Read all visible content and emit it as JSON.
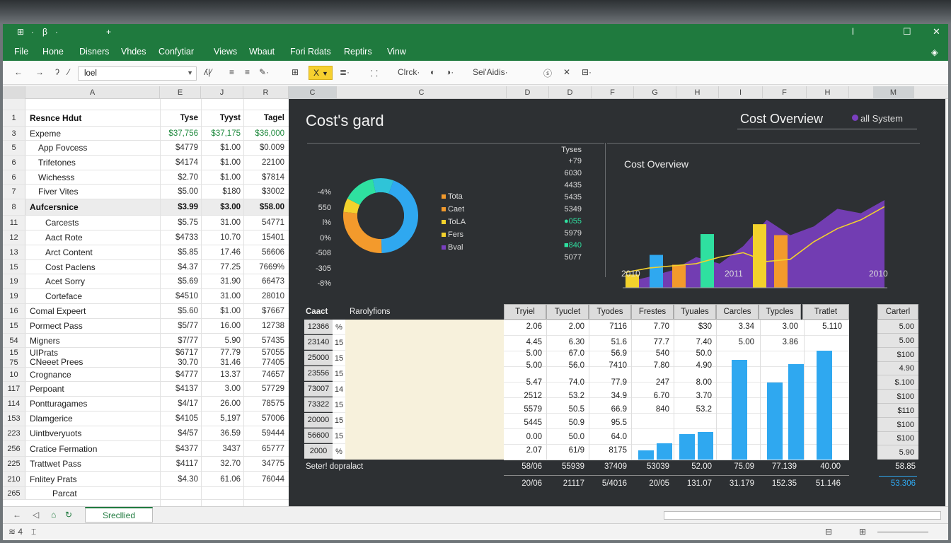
{
  "titlebar": {
    "quick_access": [
      "⊞",
      "·",
      "β",
      "·",
      "+"
    ],
    "window_controls": [
      "l",
      "☐",
      "✕"
    ]
  },
  "menu": [
    "File",
    "Hone",
    "Disners",
    "Vhdes",
    "Confytiar",
    "Views",
    "Wbaut",
    "Fori Rdats",
    "Reptirs",
    "Vinw"
  ],
  "menu_extra_icon": "◈",
  "toolbar": {
    "nav": [
      "←",
      "→",
      "ʔ",
      "⁄"
    ],
    "font_name": "loel",
    "items": [
      "ʎ|⁄",
      "≡",
      "≡",
      "✎·",
      "⊞",
      "X",
      "≣·",
      "⸬",
      "Clrck·",
      "◐",
      "◑·",
      "Sei'Aidis·",
      "ⓢ",
      "✕",
      "⊟·"
    ],
    "highlight_label": "X"
  },
  "col_headers": [
    "A",
    "E",
    "J",
    "R",
    "C",
    "C",
    "D",
    "D",
    "F",
    "G",
    "H",
    "I",
    "F",
    "H",
    "M"
  ],
  "sheet": {
    "rows": [
      {
        "rn": "",
        "name": "",
        "v": [
          "",
          "",
          ""
        ],
        "style": "spacer"
      },
      {
        "rn": "1",
        "name": "Resnce Hdut",
        "v": [
          "Tyse",
          "Tyyst",
          "Tagel"
        ],
        "style": "bold"
      },
      {
        "rn": "3",
        "name": "Expeme",
        "v": [
          "$37,756",
          "$37,175",
          "$36,000"
        ],
        "style": "green"
      },
      {
        "rn": "5",
        "name": "App Fovcess",
        "v": [
          "$4779",
          "$1.00",
          "$0.009"
        ],
        "indent": 1
      },
      {
        "rn": "6",
        "name": "Trifetones",
        "v": [
          "$4174",
          "$1.00",
          "22100"
        ],
        "indent": 1
      },
      {
        "rn": "6",
        "name": "Wichesss",
        "v": [
          "$2.70",
          "$1.00",
          "$7814"
        ],
        "indent": 1
      },
      {
        "rn": "7",
        "name": "Fiver Vites",
        "v": [
          "$5.00",
          "$180",
          "$3002"
        ],
        "indent": 1
      },
      {
        "rn": "8",
        "name": "Aufcersnice",
        "v": [
          "$3.99",
          "$3.00",
          "$58.00"
        ],
        "style": "bold shaded"
      },
      {
        "rn": "11",
        "name": "Carcests",
        "v": [
          "$5.75",
          "31.00",
          "54771"
        ],
        "indent": 2
      },
      {
        "rn": "12",
        "name": "Aact Rote",
        "v": [
          "$4733",
          "10.70",
          "15401"
        ],
        "indent": 2
      },
      {
        "rn": "13",
        "name": "Arct Content",
        "v": [
          "$5.85",
          "17.46",
          "56606"
        ],
        "indent": 2
      },
      {
        "rn": "15",
        "name": "Cost Paclens",
        "v": [
          "$4.37",
          "77.25",
          "7669%"
        ],
        "indent": 2
      },
      {
        "rn": "19",
        "name": "Acet Sorry",
        "v": [
          "$5.69",
          "31.90",
          "66473"
        ],
        "indent": 2
      },
      {
        "rn": "19",
        "name": "Corteface",
        "v": [
          "$4510",
          "31.00",
          "28010"
        ],
        "indent": 2
      },
      {
        "rn": "16",
        "name": "Comal Expeert",
        "v": [
          "$5.60",
          "$1.00",
          "$7667"
        ]
      },
      {
        "rn": "15",
        "name": "Pormect Pass",
        "v": [
          "$5/77",
          "16.00",
          "12738"
        ]
      },
      {
        "rn": "54",
        "name": "Migners",
        "v": [
          "$7/77",
          "5.90",
          "57435"
        ]
      },
      {
        "rn": "15",
        "name": "UIPrats",
        "v": [
          "$6717",
          "77.79",
          "57055"
        ],
        "half": "top"
      },
      {
        "rn": "75",
        "name": "CNeeet Prees",
        "v": [
          "30.70",
          "31.46",
          "77405"
        ],
        "half": "bottom"
      },
      {
        "rn": "10",
        "name": "Crognance",
        "v": [
          "$4777",
          "13.37",
          "74657"
        ]
      },
      {
        "rn": "117",
        "name": "Perpoant",
        "v": [
          "$4137",
          "3.00",
          "57729"
        ]
      },
      {
        "rn": "114",
        "name": "Pontturagames",
        "v": [
          "$4/17",
          "26.00",
          "78575"
        ]
      },
      {
        "rn": "153",
        "name": "Dlamgerice",
        "v": [
          "$4105",
          "5,197",
          "57006"
        ]
      },
      {
        "rn": "223",
        "name": "Uintbveryuots",
        "v": [
          "$4/57",
          "36.59",
          "59444"
        ]
      },
      {
        "rn": "256",
        "name": "Cratice Fermation",
        "v": [
          "$4377",
          "3437",
          "65777"
        ]
      },
      {
        "rn": "225",
        "name": "Trattwet Pass",
        "v": [
          "$4117",
          "32.70",
          "34775"
        ]
      },
      {
        "rn": "210",
        "name": "Fnlitey Prats",
        "v": [
          "$4.30",
          "61.06",
          "76044"
        ]
      },
      {
        "rn": "265",
        "name": "Parcat",
        "v": [
          "",
          "",
          ""
        ],
        "indent": 3
      }
    ]
  },
  "dashboard": {
    "title": "Cost's gard",
    "overview_title": "Cost Overview",
    "system_label": "all System",
    "system_color": "#7a3fc0",
    "donut_axis": [
      "-4%",
      "550",
      "l%",
      "0%",
      "-508",
      "-305",
      "-8%"
    ],
    "donut_slices": [
      {
        "color": "#2fa8f0",
        "value": 44
      },
      {
        "color": "#f39a2c",
        "value": 27
      },
      {
        "color": "#f3d22c",
        "value": 6
      },
      {
        "color": "#2fe0a0",
        "value": 14
      },
      {
        "color": "#2fc4d8",
        "value": 9
      }
    ],
    "legend": [
      {
        "label": "Tota",
        "color": "#f39a2c"
      },
      {
        "label": "Caet",
        "color": "#f39a2c"
      },
      {
        "label": "ToLA",
        "color": "#f3d22c"
      },
      {
        "label": "Fers",
        "color": "#f3d22c"
      },
      {
        "label": "Bval",
        "color": "#7a3fc0"
      }
    ],
    "types_header": "Tyses",
    "types_values": [
      "+79",
      "6030",
      "4435",
      "5435",
      "5349",
      "●055",
      "5979",
      "■840",
      "5077"
    ],
    "types_markers": {
      "5": "#2fe0a0",
      "7": "#2fe0a0"
    },
    "chart_data": {
      "type": "bar",
      "title": "Cost Overview",
      "x_ticks": [
        "2010",
        "2011",
        "2010"
      ],
      "bars": [
        {
          "color": "#f3d22c",
          "value": 12
        },
        {
          "color": "#2fa8f0",
          "value": 30
        },
        {
          "color": "#f39a2c",
          "value": 21
        },
        {
          "color": "#2fe0a0",
          "value": 49
        },
        {
          "color": "#f3d22c",
          "value": 58
        },
        {
          "color": "#f39a2c",
          "value": 48
        }
      ],
      "area_values": [
        5,
        10,
        16,
        28,
        22,
        38,
        62,
        48,
        56,
        72,
        68,
        80
      ],
      "area_color": "#7a3fc0",
      "line_values": [
        14,
        18,
        20,
        22,
        28,
        32,
        24,
        26,
        42,
        54,
        62,
        74
      ],
      "line_color": "#f3d22c",
      "ylim": [
        0,
        100
      ]
    },
    "table": {
      "header_left": "Caact",
      "header_mid": "Rarolyfions",
      "col_headers": [
        "Tryiel",
        "Tyuclet",
        "Tyodes",
        "Frestes",
        "Tyuales",
        "Carcles",
        "Typcles",
        "Tratlet"
      ],
      "right_header": "Carterl",
      "left_col": [
        "12366",
        "23140",
        "25000",
        "23556",
        "73007",
        "73322",
        "20000",
        "56600",
        "2000"
      ],
      "mid_col": [
        "%",
        "15",
        "15",
        "15",
        "14",
        "15",
        "15",
        "15",
        "%"
      ],
      "grid_rows": [
        [
          "2.06",
          "2.00",
          "7116",
          "7.70",
          "$30",
          "3.34",
          "3.00",
          "5.110"
        ],
        [
          "4.45",
          "6.30",
          "51.6",
          "77.7",
          "7.40",
          "5.00",
          "3.86",
          ""
        ],
        [
          "5.00",
          "67.0",
          "56.9",
          "540",
          "50.0",
          "",
          "",
          ""
        ],
        [
          "5.00",
          "56.0",
          "7410",
          "7.80",
          "4.90",
          "",
          "",
          ""
        ],
        [
          "5.47",
          "74.0",
          "77.9",
          "247",
          "8.00",
          "",
          "",
          ""
        ],
        [
          "2512",
          "53.2",
          "34.9",
          "6.70",
          "3.70",
          "",
          "",
          ""
        ],
        [
          "5579",
          "50.5",
          "66.9",
          "840",
          "53.2",
          "",
          "",
          ""
        ],
        [
          "5445",
          "50.9",
          "95.5",
          "",
          "",
          "",
          "",
          ""
        ],
        [
          "0.00",
          "50.0",
          "64.0",
          "",
          "",
          "",
          "",
          ""
        ],
        [
          "2.07",
          "61/9",
          "8175",
          "",
          "",
          "",
          "",
          ""
        ]
      ],
      "right_col": [
        "5.00",
        "5.00",
        "$100",
        "4.90",
        "$.100",
        "$100",
        "$110",
        "$100",
        "$100",
        "5.90"
      ],
      "mini_bars": [
        {
          "color": "#2fa8f0",
          "value": 10
        },
        {
          "color": "#2fa8f0",
          "value": 18
        },
        {
          "color": "#2fa8f0",
          "value": 28
        },
        {
          "color": "#2fa8f0",
          "value": 30
        },
        {
          "color": "#2fa8f0",
          "value": 110
        },
        {
          "color": "#2fa8f0",
          "value": 85
        },
        {
          "color": "#2fa8f0",
          "value": 105
        },
        {
          "color": "#2fa8f0",
          "value": 120
        }
      ],
      "footer_label": "Seter! dopralact",
      "footer_row1": [
        "58/06",
        "55939",
        "37409",
        "53039",
        "52.00",
        "75.09",
        "77.139",
        "40.00"
      ],
      "footer_row2": [
        "20/06",
        "21117",
        "5/4016",
        "20/05",
        "131.07",
        "31.179",
        "152.35",
        "51.146"
      ],
      "footer_right1": "58.85",
      "footer_right2": "53.306",
      "footer_right2_color": "#2fa8f0"
    }
  },
  "sheet_tabs": {
    "nav": [
      "←",
      "◁",
      "⌂",
      "↻"
    ],
    "active": "Srecllied"
  },
  "statusbar": {
    "left": [
      "≋ 4",
      "⌶"
    ],
    "right": [
      "⊟",
      "⊞"
    ]
  }
}
